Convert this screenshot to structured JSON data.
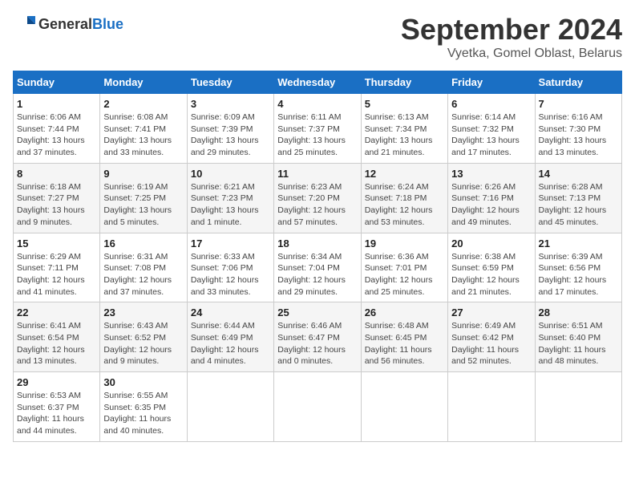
{
  "header": {
    "logo_general": "General",
    "logo_blue": "Blue",
    "month_title": "September 2024",
    "location": "Vyetka, Gomel Oblast, Belarus"
  },
  "weekdays": [
    "Sunday",
    "Monday",
    "Tuesday",
    "Wednesday",
    "Thursday",
    "Friday",
    "Saturday"
  ],
  "weeks": [
    [
      {
        "day": "1",
        "sunrise": "Sunrise: 6:06 AM",
        "sunset": "Sunset: 7:44 PM",
        "daylight": "Daylight: 13 hours and 37 minutes."
      },
      {
        "day": "2",
        "sunrise": "Sunrise: 6:08 AM",
        "sunset": "Sunset: 7:41 PM",
        "daylight": "Daylight: 13 hours and 33 minutes."
      },
      {
        "day": "3",
        "sunrise": "Sunrise: 6:09 AM",
        "sunset": "Sunset: 7:39 PM",
        "daylight": "Daylight: 13 hours and 29 minutes."
      },
      {
        "day": "4",
        "sunrise": "Sunrise: 6:11 AM",
        "sunset": "Sunset: 7:37 PM",
        "daylight": "Daylight: 13 hours and 25 minutes."
      },
      {
        "day": "5",
        "sunrise": "Sunrise: 6:13 AM",
        "sunset": "Sunset: 7:34 PM",
        "daylight": "Daylight: 13 hours and 21 minutes."
      },
      {
        "day": "6",
        "sunrise": "Sunrise: 6:14 AM",
        "sunset": "Sunset: 7:32 PM",
        "daylight": "Daylight: 13 hours and 17 minutes."
      },
      {
        "day": "7",
        "sunrise": "Sunrise: 6:16 AM",
        "sunset": "Sunset: 7:30 PM",
        "daylight": "Daylight: 13 hours and 13 minutes."
      }
    ],
    [
      {
        "day": "8",
        "sunrise": "Sunrise: 6:18 AM",
        "sunset": "Sunset: 7:27 PM",
        "daylight": "Daylight: 13 hours and 9 minutes."
      },
      {
        "day": "9",
        "sunrise": "Sunrise: 6:19 AM",
        "sunset": "Sunset: 7:25 PM",
        "daylight": "Daylight: 13 hours and 5 minutes."
      },
      {
        "day": "10",
        "sunrise": "Sunrise: 6:21 AM",
        "sunset": "Sunset: 7:23 PM",
        "daylight": "Daylight: 13 hours and 1 minute."
      },
      {
        "day": "11",
        "sunrise": "Sunrise: 6:23 AM",
        "sunset": "Sunset: 7:20 PM",
        "daylight": "Daylight: 12 hours and 57 minutes."
      },
      {
        "day": "12",
        "sunrise": "Sunrise: 6:24 AM",
        "sunset": "Sunset: 7:18 PM",
        "daylight": "Daylight: 12 hours and 53 minutes."
      },
      {
        "day": "13",
        "sunrise": "Sunrise: 6:26 AM",
        "sunset": "Sunset: 7:16 PM",
        "daylight": "Daylight: 12 hours and 49 minutes."
      },
      {
        "day": "14",
        "sunrise": "Sunrise: 6:28 AM",
        "sunset": "Sunset: 7:13 PM",
        "daylight": "Daylight: 12 hours and 45 minutes."
      }
    ],
    [
      {
        "day": "15",
        "sunrise": "Sunrise: 6:29 AM",
        "sunset": "Sunset: 7:11 PM",
        "daylight": "Daylight: 12 hours and 41 minutes."
      },
      {
        "day": "16",
        "sunrise": "Sunrise: 6:31 AM",
        "sunset": "Sunset: 7:08 PM",
        "daylight": "Daylight: 12 hours and 37 minutes."
      },
      {
        "day": "17",
        "sunrise": "Sunrise: 6:33 AM",
        "sunset": "Sunset: 7:06 PM",
        "daylight": "Daylight: 12 hours and 33 minutes."
      },
      {
        "day": "18",
        "sunrise": "Sunrise: 6:34 AM",
        "sunset": "Sunset: 7:04 PM",
        "daylight": "Daylight: 12 hours and 29 minutes."
      },
      {
        "day": "19",
        "sunrise": "Sunrise: 6:36 AM",
        "sunset": "Sunset: 7:01 PM",
        "daylight": "Daylight: 12 hours and 25 minutes."
      },
      {
        "day": "20",
        "sunrise": "Sunrise: 6:38 AM",
        "sunset": "Sunset: 6:59 PM",
        "daylight": "Daylight: 12 hours and 21 minutes."
      },
      {
        "day": "21",
        "sunrise": "Sunrise: 6:39 AM",
        "sunset": "Sunset: 6:56 PM",
        "daylight": "Daylight: 12 hours and 17 minutes."
      }
    ],
    [
      {
        "day": "22",
        "sunrise": "Sunrise: 6:41 AM",
        "sunset": "Sunset: 6:54 PM",
        "daylight": "Daylight: 12 hours and 13 minutes."
      },
      {
        "day": "23",
        "sunrise": "Sunrise: 6:43 AM",
        "sunset": "Sunset: 6:52 PM",
        "daylight": "Daylight: 12 hours and 9 minutes."
      },
      {
        "day": "24",
        "sunrise": "Sunrise: 6:44 AM",
        "sunset": "Sunset: 6:49 PM",
        "daylight": "Daylight: 12 hours and 4 minutes."
      },
      {
        "day": "25",
        "sunrise": "Sunrise: 6:46 AM",
        "sunset": "Sunset: 6:47 PM",
        "daylight": "Daylight: 12 hours and 0 minutes."
      },
      {
        "day": "26",
        "sunrise": "Sunrise: 6:48 AM",
        "sunset": "Sunset: 6:45 PM",
        "daylight": "Daylight: 11 hours and 56 minutes."
      },
      {
        "day": "27",
        "sunrise": "Sunrise: 6:49 AM",
        "sunset": "Sunset: 6:42 PM",
        "daylight": "Daylight: 11 hours and 52 minutes."
      },
      {
        "day": "28",
        "sunrise": "Sunrise: 6:51 AM",
        "sunset": "Sunset: 6:40 PM",
        "daylight": "Daylight: 11 hours and 48 minutes."
      }
    ],
    [
      {
        "day": "29",
        "sunrise": "Sunrise: 6:53 AM",
        "sunset": "Sunset: 6:37 PM",
        "daylight": "Daylight: 11 hours and 44 minutes."
      },
      {
        "day": "30",
        "sunrise": "Sunrise: 6:55 AM",
        "sunset": "Sunset: 6:35 PM",
        "daylight": "Daylight: 11 hours and 40 minutes."
      },
      null,
      null,
      null,
      null,
      null
    ]
  ]
}
